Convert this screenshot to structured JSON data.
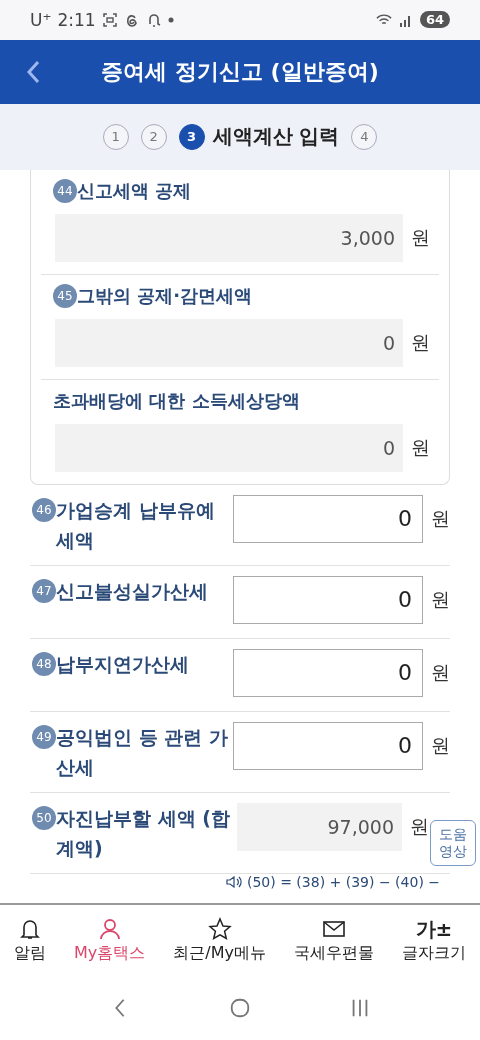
{
  "status_bar": {
    "carrier": "U⁺",
    "time": "2:11",
    "battery": "64"
  },
  "header": {
    "title": "증여세 정기신고 (일반증여)"
  },
  "steps": [
    {
      "label": "1",
      "selected": false
    },
    {
      "label": "2",
      "selected": false
    },
    {
      "label": "3",
      "title": "세액계산 입력",
      "selected": true
    },
    {
      "label": "4",
      "selected": false
    }
  ],
  "card": {
    "items": [
      {
        "badge": "44",
        "label": "신고세액 공제",
        "value": "3,000",
        "unit": "원"
      },
      {
        "badge": "45",
        "label": "그밖의 공제·감면세액",
        "value": "0",
        "unit": "원"
      },
      {
        "label": "초과배당에 대한 소득세상당액",
        "value": "0",
        "unit": "원"
      }
    ]
  },
  "rows": [
    {
      "badge": "46",
      "label": "가업승계 납부유예 세액",
      "value": "0",
      "unit": "원",
      "kind": "input"
    },
    {
      "badge": "47",
      "label": "신고불성실가산세",
      "value": "0",
      "unit": "원",
      "kind": "input"
    },
    {
      "badge": "48",
      "label": "납부지연가산세",
      "value": "0",
      "unit": "원",
      "kind": "input"
    },
    {
      "badge": "49",
      "label": "공익법인 등 관련 가산세",
      "value": "0",
      "unit": "원",
      "kind": "input"
    },
    {
      "badge": "50",
      "label": "자진납부할 세액 (합계액)",
      "value": "97,000",
      "unit": "원",
      "kind": "readonly"
    }
  ],
  "formula": "(50) = (38) + (39) − (40) −",
  "help_button": "도움 영상",
  "bottom_nav": [
    {
      "label": "알림",
      "selected": false
    },
    {
      "label": "My홈택스",
      "selected": true
    },
    {
      "label": "최근/My메뉴",
      "selected": false
    },
    {
      "label": "국세우편물",
      "selected": false
    },
    {
      "label": "글자크기",
      "glyph": "가±",
      "selected": false
    }
  ]
}
